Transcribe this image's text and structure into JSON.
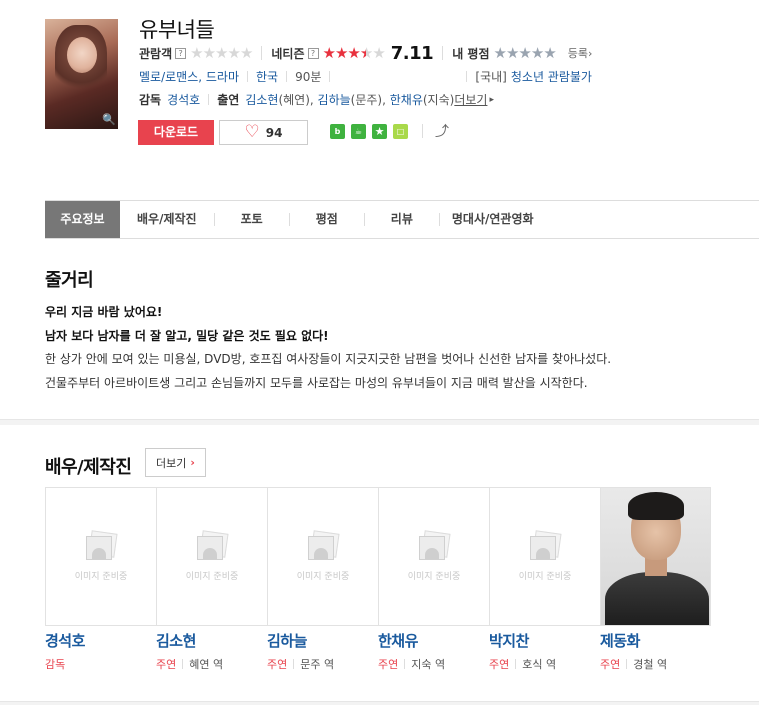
{
  "movie": {
    "title": "유부녀들"
  },
  "ratings": {
    "audience_label": "관람객",
    "netizen_label": "네티즌",
    "netizen_score": "7.11",
    "netizen_score_value": 7.11,
    "my_label": "내 평점",
    "register_label": "등록",
    "colors": {
      "star_filled": "#e8313e",
      "star_empty": "#d8d8d8"
    }
  },
  "info": {
    "genre": "멜로/로맨스, 드라마",
    "country": "한국",
    "runtime": "90분",
    "rating_prefix": "[국내]",
    "rating": "청소년 관람불가"
  },
  "credits": {
    "director_label": "감독",
    "director": "경석호",
    "cast_label": "출연",
    "cast": [
      {
        "name": "김소현",
        "role": "(혜연)"
      },
      {
        "name": "김하늘",
        "role": "(문주)"
      },
      {
        "name": "한채유",
        "role": "(지숙)"
      }
    ],
    "more_label": "더보기"
  },
  "actions": {
    "download_label": "다운로드",
    "like_count": "94",
    "share_icons": [
      "blog-icon",
      "cafe-icon",
      "star-icon",
      "band-icon"
    ],
    "accent_color": "#e8434e"
  },
  "tabs": [
    {
      "label": "주요정보",
      "active": true
    },
    {
      "label": "배우/제작진",
      "active": false
    },
    {
      "label": "포토",
      "active": false
    },
    {
      "label": "평점",
      "active": false
    },
    {
      "label": "리뷰",
      "active": false
    },
    {
      "label": "명대사/연관영화",
      "active": false
    }
  ],
  "synopsis": {
    "title": "줄거리",
    "headline1": "우리 지금 바람 났어요!",
    "headline2": "남자 보다 남자를 더 잘 알고, 밀당 같은 것도 필요 없다!",
    "body1": "한 상가 안에 모여 있는 미용실, DVD방, 호프집 여사장들이 지긋지긋한 남편을 벗어나 신선한 남자를 찾아나섰다.",
    "body2": "건물주부터 아르바이트생 그리고 손님들까지 모두를 사로잡는 마성의 유부녀들이 지금 매력 발산을 시작한다."
  },
  "cast_section": {
    "title": "배우/제작진",
    "more_label": "더보기",
    "no_image_text": "이미지 준비중",
    "people": [
      {
        "name": "경석호",
        "type": "감독",
        "character": ""
      },
      {
        "name": "김소현",
        "type": "주연",
        "character": "혜연 역"
      },
      {
        "name": "김하늘",
        "type": "주연",
        "character": "문주 역"
      },
      {
        "name": "한채유",
        "type": "주연",
        "character": "지숙 역"
      },
      {
        "name": "박지찬",
        "type": "주연",
        "character": "호식 역"
      },
      {
        "name": "제동화",
        "type": "주연",
        "character": "경철 역"
      }
    ]
  }
}
